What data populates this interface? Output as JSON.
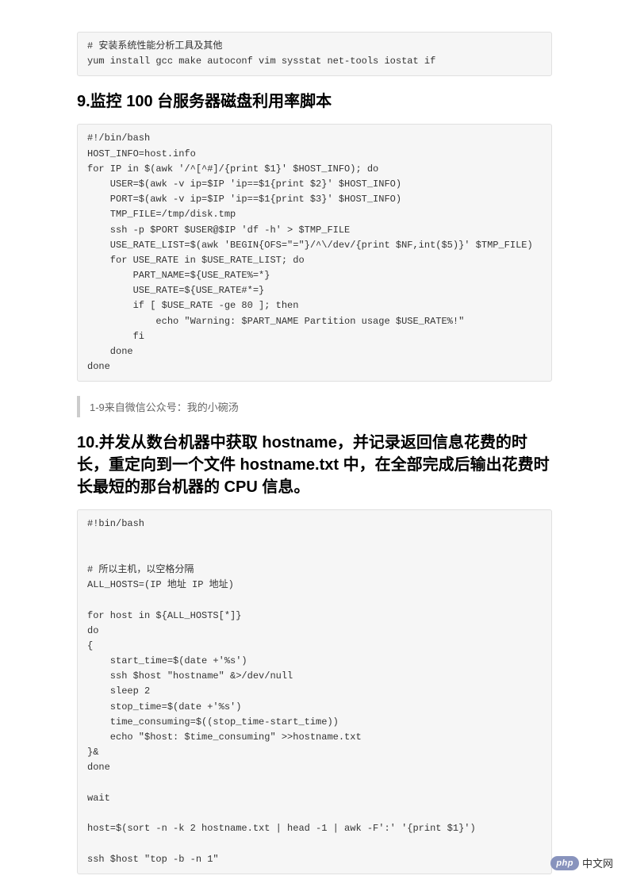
{
  "code1": "# 安装系统性能分析工具及其他\nyum install gcc make autoconf vim sysstat net-tools iostat if",
  "heading1": "9.监控 100 台服务器磁盘利用率脚本",
  "code2": "#!/bin/bash\nHOST_INFO=host.info\nfor IP in $(awk '/^[^#]/{print $1}' $HOST_INFO); do\n    USER=$(awk -v ip=$IP 'ip==$1{print $2}' $HOST_INFO)\n    PORT=$(awk -v ip=$IP 'ip==$1{print $3}' $HOST_INFO)\n    TMP_FILE=/tmp/disk.tmp\n    ssh -p $PORT $USER@$IP 'df -h' > $TMP_FILE\n    USE_RATE_LIST=$(awk 'BEGIN{OFS=\"=\"}/^\\/dev/{print $NF,int($5)}' $TMP_FILE)\n    for USE_RATE in $USE_RATE_LIST; do\n        PART_NAME=${USE_RATE%=*}\n        USE_RATE=${USE_RATE#*=}\n        if [ $USE_RATE -ge 80 ]; then\n            echo \"Warning: $PART_NAME Partition usage $USE_RATE%!\"\n        fi\n    done\ndone",
  "quote1": "1-9来自微信公众号：我的小碗汤",
  "heading2": "10.并发从数台机器中获取 hostname，并记录返回信息花费的时长，重定向到一个文件 hostname.txt 中，在全部完成后输出花费时长最短的那台机器的 CPU 信息。",
  "code3": "#!bin/bash\n\n\n# 所以主机，以空格分隔\nALL_HOSTS=(IP 地址 IP 地址)\n\nfor host in ${ALL_HOSTS[*]}\ndo\n{\n    start_time=$(date +'%s')\n    ssh $host \"hostname\" &>/dev/null\n    sleep 2\n    stop_time=$(date +'%s')\n    time_consuming=$((stop_time-start_time))\n    echo \"$host: $time_consuming\" >>hostname.txt\n}&\ndone\n\nwait\n\nhost=$(sort -n -k 2 hostname.txt | head -1 | awk -F':' '{print $1}')\n\nssh $host \"top -b -n 1\"",
  "footer": {
    "badge": "php",
    "text": "中文网"
  }
}
